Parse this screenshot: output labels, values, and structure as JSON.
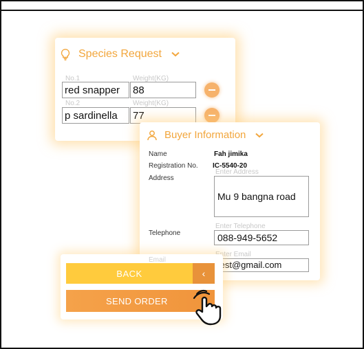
{
  "species": {
    "title": "Species Request",
    "rows": [
      {
        "no_label": "No.1",
        "weight_label": "Weight(KG)",
        "name": "red snapper",
        "weight": "88"
      },
      {
        "no_label": "No.2",
        "weight_label": "Weight(KG)",
        "name": "p sardinella",
        "weight": "77"
      }
    ]
  },
  "buyer": {
    "title": "Buyer Information",
    "name_label": "Name",
    "name_value": "Fah jimika",
    "reg_label": "Registration No.",
    "reg_value": "IC-5540-20",
    "address_label": "Address",
    "address_hint": "Enter Address",
    "address_value": "Mu 9 bangna road",
    "tel_label": "Telephone",
    "tel_hint": "Enter Telephone",
    "tel_value": "088-949-5652",
    "email_label": "Email",
    "email_hint": "Enter Email",
    "email_value": "test@gmail.com"
  },
  "actions": {
    "back_label": "BACK",
    "back_arrow": "‹",
    "send_label": "SEND ORDER"
  },
  "colors": {
    "accent_orange": "#f2a63c",
    "back_yellow": "#ffcb3d",
    "send_orange": "#f0943b"
  },
  "icons": {
    "species": "lightbulb-icon",
    "buyer": "person-icon",
    "chevron": "chevron-down-icon",
    "remove": "minus-circle-icon",
    "pointer": "tap-hand-icon"
  }
}
